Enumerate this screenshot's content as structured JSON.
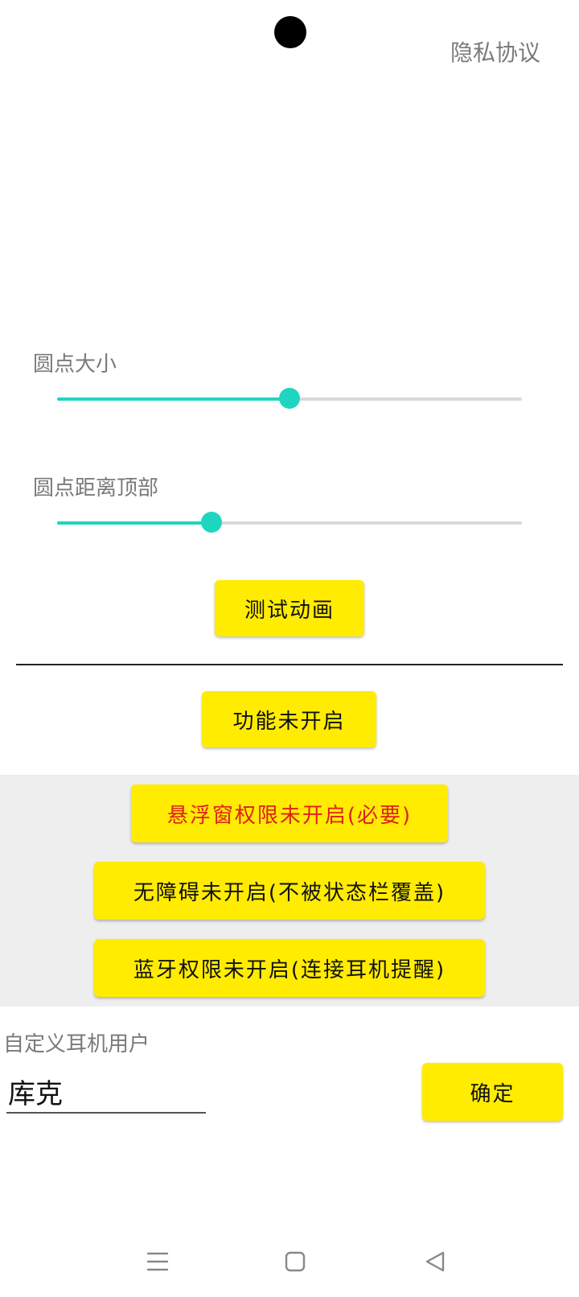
{
  "header": {
    "privacy_link": "隐私协议"
  },
  "sliders": [
    {
      "label": "圆点大小",
      "value_fraction": 0.5
    },
    {
      "label": "圆点距离顶部",
      "value_fraction": 0.333
    }
  ],
  "buttons": {
    "test_animation": "测试动画",
    "feature_status": "功能未开启",
    "overlay_permission": "悬浮窗权限未开启(必要)",
    "accessibility": "无障碍未开启(不被状态栏覆盖)",
    "bluetooth_permission": "蓝牙权限未开启(连接耳机提醒)",
    "confirm": "确定"
  },
  "custom_user": {
    "label": "自定义耳机用户",
    "value": "库克"
  },
  "colors": {
    "accent": "#1ed6c0",
    "button_yellow": "#ffec00",
    "warning_red": "#e0201a",
    "band_grey": "#eeeeee"
  },
  "nav_bar": {
    "icons": [
      "menu-icon",
      "home-square-icon",
      "back-triangle-icon"
    ]
  }
}
